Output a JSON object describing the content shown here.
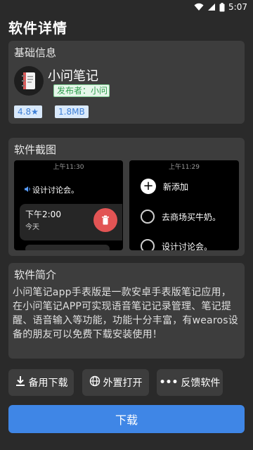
{
  "status_bar": {
    "time": "5:07"
  },
  "page": {
    "title": "软件详情"
  },
  "basic_info": {
    "title": "基础信息",
    "app_name": "小问笔记",
    "publisher": "发布者：小问",
    "rating": "4.8★",
    "size": "1.8MB"
  },
  "screenshots": {
    "title": "软件截图",
    "shot1": {
      "time": "上午11:30",
      "voice_note": "设计讨论会。",
      "item_time": "下午2:00",
      "item_day": "今天"
    },
    "shot2": {
      "time": "上午11:29",
      "add_label": "新添加",
      "todo1": "去商场买牛奶。",
      "todo2": "设计讨论会。"
    }
  },
  "intro": {
    "title": "软件简介",
    "text": "小问笔记app手表版是一款安卓手表版笔记应用，在小问笔记APP可实现语音笔记记录管理、笔记提醒、语音输入等功能，功能十分丰富，有wearos设备的朋友可以免费下载安装使用！"
  },
  "actions": {
    "backup_download": "备用下载",
    "external_open": "外置打开",
    "feedback": "反馈软件"
  },
  "download": {
    "label": "下载"
  },
  "colors": {
    "primary": "#3f86e6",
    "card": "#3d3d3d",
    "background": "#2a2a2a",
    "delete": "#e25454"
  }
}
